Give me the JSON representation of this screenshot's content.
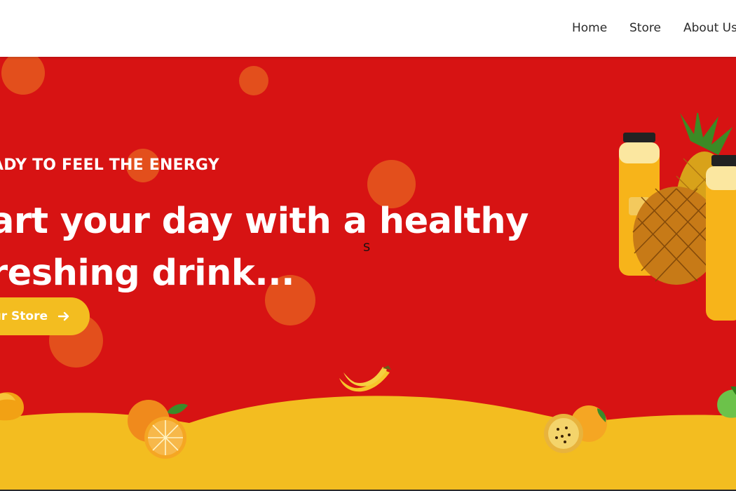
{
  "nav": {
    "links": [
      {
        "label": "Home"
      },
      {
        "label": "Store"
      },
      {
        "label": "About Us"
      }
    ]
  },
  "hero": {
    "kicker": "ADY TO FEEL THE ENERGY",
    "headline_line1": "art your day with a healthy",
    "headline_line2": "reshing drink...",
    "stray_char": "S",
    "cta_label": "ur Store"
  },
  "colors": {
    "background_red": "#d71313",
    "accent_yellow": "#f3bd20",
    "bubble_orange": "#e4571e",
    "nav_bg": "#ffffff",
    "nav_text": "#2b2b2b"
  },
  "icons": {
    "cta_icon": "arrow-right-icon"
  }
}
